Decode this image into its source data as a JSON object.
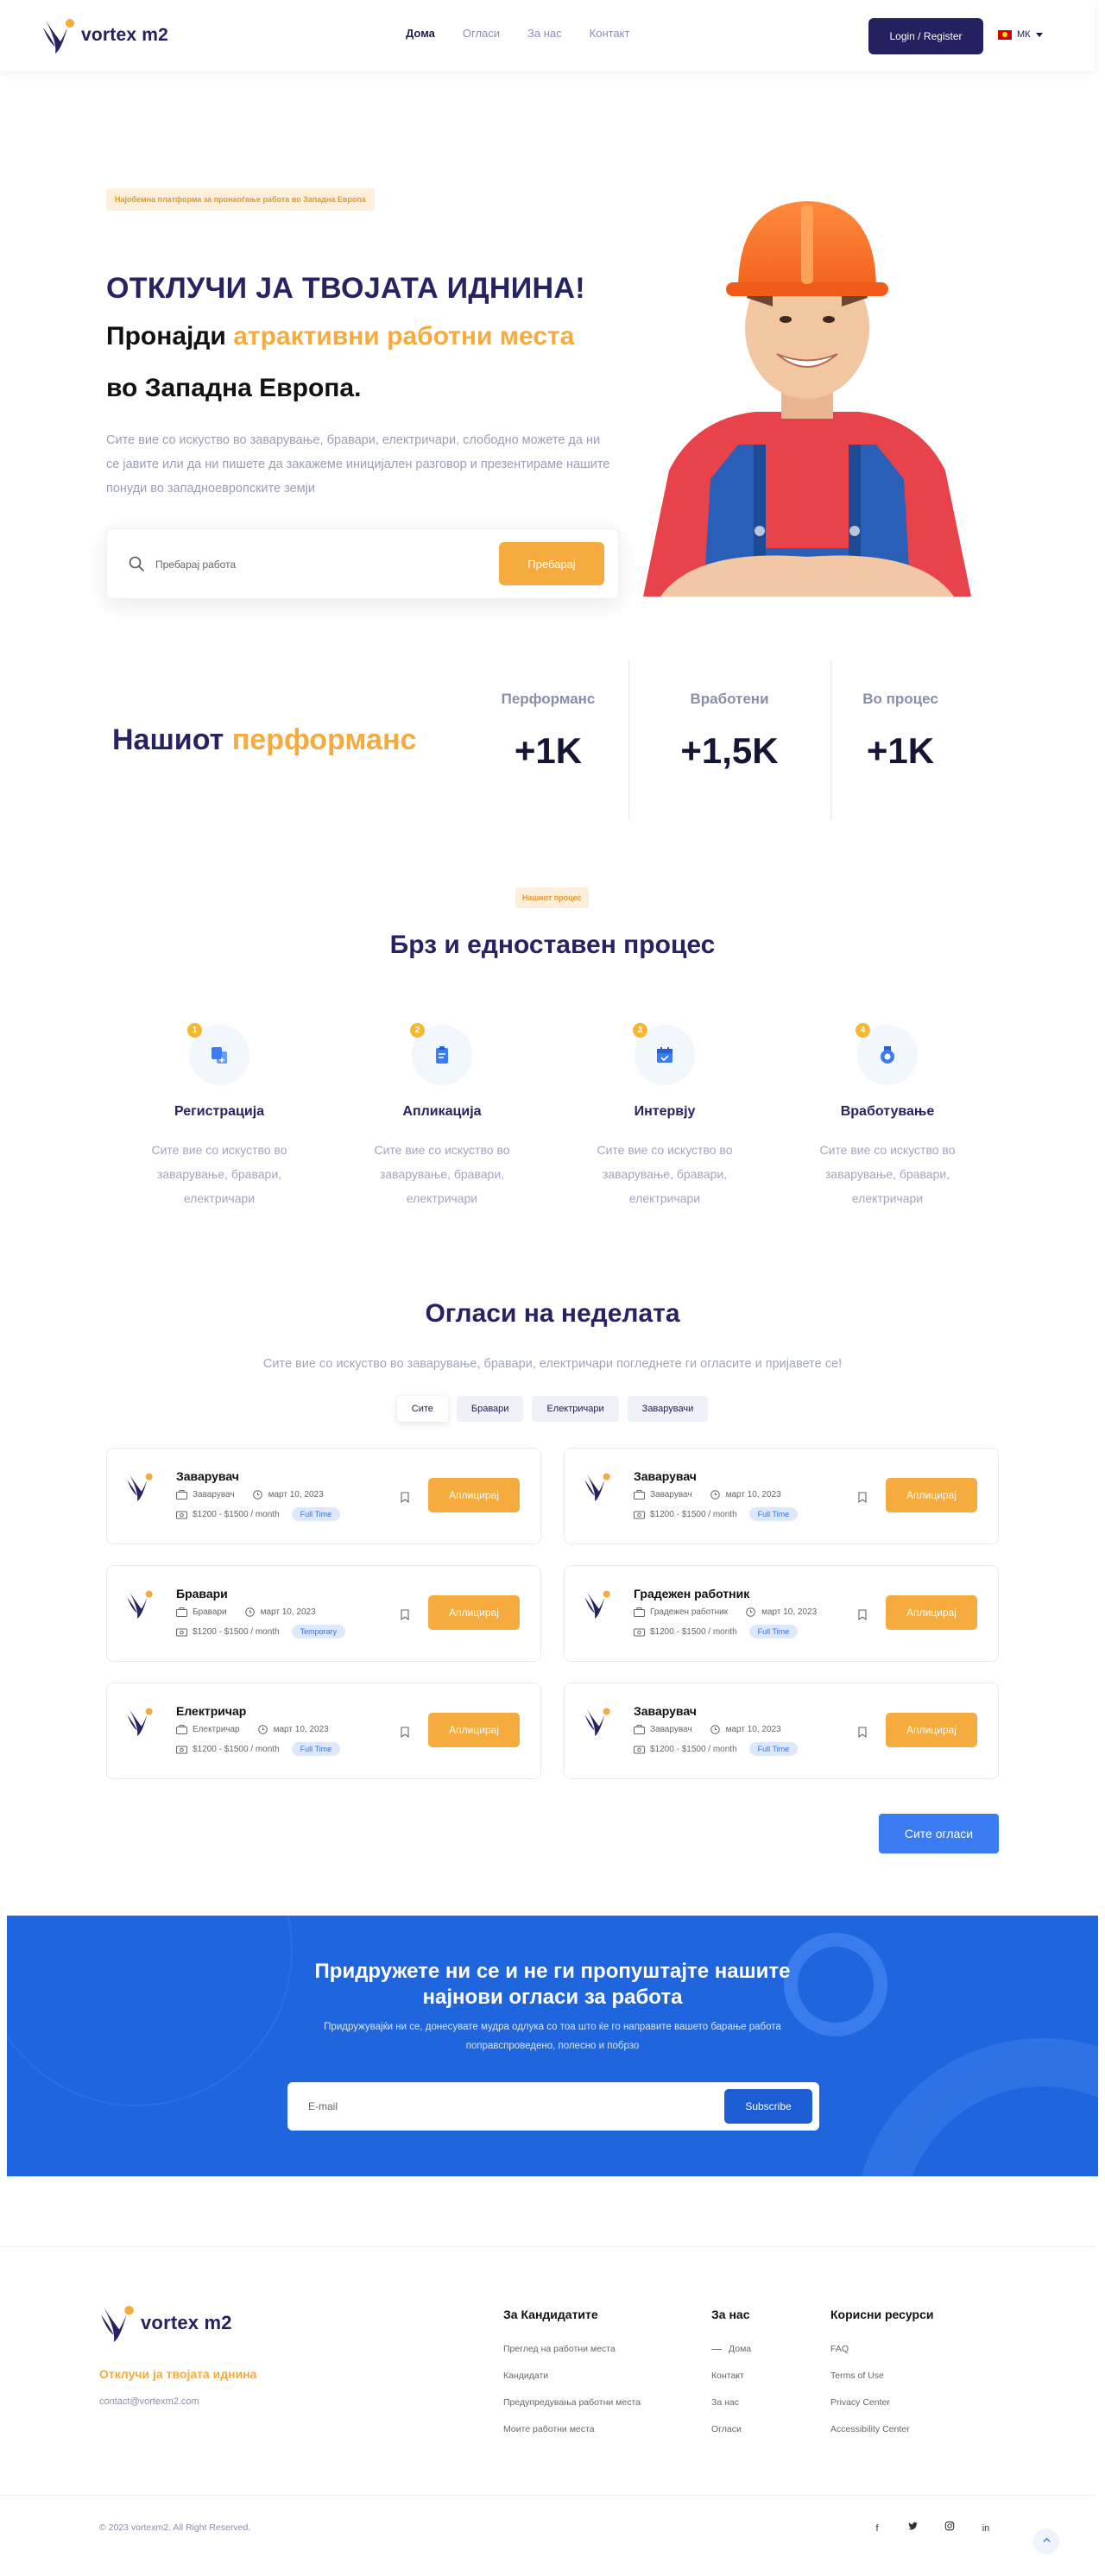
{
  "brand": {
    "name": "vortex m2"
  },
  "nav": {
    "links": [
      "Дома",
      "Огласи",
      "За нас",
      "Контакт"
    ],
    "login_label": "Login / Register",
    "lang_label": "МК"
  },
  "hero": {
    "badge": "Најобемна платформа за пронаоѓање работа во Западна Европа",
    "title": "ОТКЛУЧИ ЈА ТВОЈАТА ИДНИНА!",
    "line2_prefix": "Пронајди ",
    "line2_accent": "атрактивни работни места",
    "line3": "во Западна Европа.",
    "paragraph": "Сите вие со искуство во заварување, бравари, електричари, слободно можете да ни се јавите или да ни пишете да закажеме иницијален разговор и презентираме нашите понуди во западноевропските земји",
    "search_placeholder": "Пребарај работа",
    "search_button": "Пребарај"
  },
  "performance": {
    "title_prefix": "Нашиот ",
    "title_accent": "перформанс",
    "stats": [
      {
        "label": "Перформанс",
        "value": "+1K"
      },
      {
        "label": "Вработени",
        "value": "+1,5K"
      },
      {
        "label": "Во процес",
        "value": "+1K"
      }
    ]
  },
  "process": {
    "badge": "Нашиот процес",
    "title": "Брз и едноставен процес",
    "steps": [
      {
        "num": "1",
        "title": "Регистрација",
        "text": "Сите вие со искуство во заварување, бравари, електричари",
        "icon": "copy-icon"
      },
      {
        "num": "2",
        "title": "Апликација",
        "text": "Сите вие со искуство во заварување, бравари, електричари",
        "icon": "clipboard-icon"
      },
      {
        "num": "3",
        "title": "Интервју",
        "text": "Сите вие со искуство во заварување, бравари, електричари",
        "icon": "calendar-check-icon"
      },
      {
        "num": "4",
        "title": "Вработување",
        "text": "Сите вие со искуство во заварување, бравари, електричари",
        "icon": "badge-icon"
      }
    ]
  },
  "jobs": {
    "title": "Огласи на неделата",
    "subtitle": "Сите вие со искуство во заварување, бравари, електричари погледнете ги огласите и пријавете се!",
    "filters": [
      "Сите",
      "Бравари",
      "Електричари",
      "Заварувачи"
    ],
    "apply_label": "Аплицирај",
    "all_label": "Сите огласи",
    "cards": [
      {
        "title": "Заварувач",
        "category": "Заварувач",
        "date": "март 10, 2023",
        "salary": "$1200 - $1500 / month",
        "type": "Full Time"
      },
      {
        "title": "Заварувач",
        "category": "Заварувач",
        "date": "март 10, 2023",
        "salary": "$1200 - $1500 / month",
        "type": "Full Time"
      },
      {
        "title": "Бравари",
        "category": "Бравари",
        "date": "март 10, 2023",
        "salary": "$1200 - $1500 / month",
        "type": "Temporary"
      },
      {
        "title": "Градежен работник",
        "category": "Градежен работник",
        "date": "март 10, 2023",
        "salary": "$1200 - $1500 / month",
        "type": "Full Time"
      },
      {
        "title": "Електричар",
        "category": "Електричар",
        "date": "март 10, 2023",
        "salary": "$1200 - $1500 / month",
        "type": "Full Time"
      },
      {
        "title": "Заварувач",
        "category": "Заварувач",
        "date": "март 10, 2023",
        "salary": "$1200 - $1500 / month",
        "type": "Full Time"
      }
    ]
  },
  "newsletter": {
    "title_line1": "Придружете ни се и не ги пропуштајте нашите",
    "title_line2": "најнови огласи за работа",
    "text_line1": "Придружувајќи ни се, донесувате мудра одлука со тоа што ќе го направите вашето барање работа",
    "text_line2": "поправспроведено, полесно и побрзо",
    "placeholder": "E-mail",
    "button": "Subscribe"
  },
  "footer": {
    "tagline": "Отклучи ја твојата иднина",
    "email": "contact@vortexm2.com",
    "columns": [
      {
        "title": "За Кандидатите",
        "links": [
          "Преглед на работни места",
          "Кандидати",
          "Предупредувања работни места",
          "Моите работни места"
        ]
      },
      {
        "title": "За нас",
        "links": [
          "Дома",
          "Контакт",
          "За нас",
          "Огласи"
        ]
      },
      {
        "title": "Корисни ресурси",
        "links": [
          "FAQ",
          "Terms of Use",
          "Privacy Center",
          "Accessibility Center"
        ]
      }
    ],
    "copyright": "© 2023 vortexm2. All Right Reserved.",
    "socials": [
      "f",
      "t",
      "ig",
      "in"
    ]
  },
  "colors": {
    "navy": "#262363",
    "orange": "#f6ab3e",
    "blue": "#1f65dd",
    "button_blue": "#3b7cf2"
  }
}
